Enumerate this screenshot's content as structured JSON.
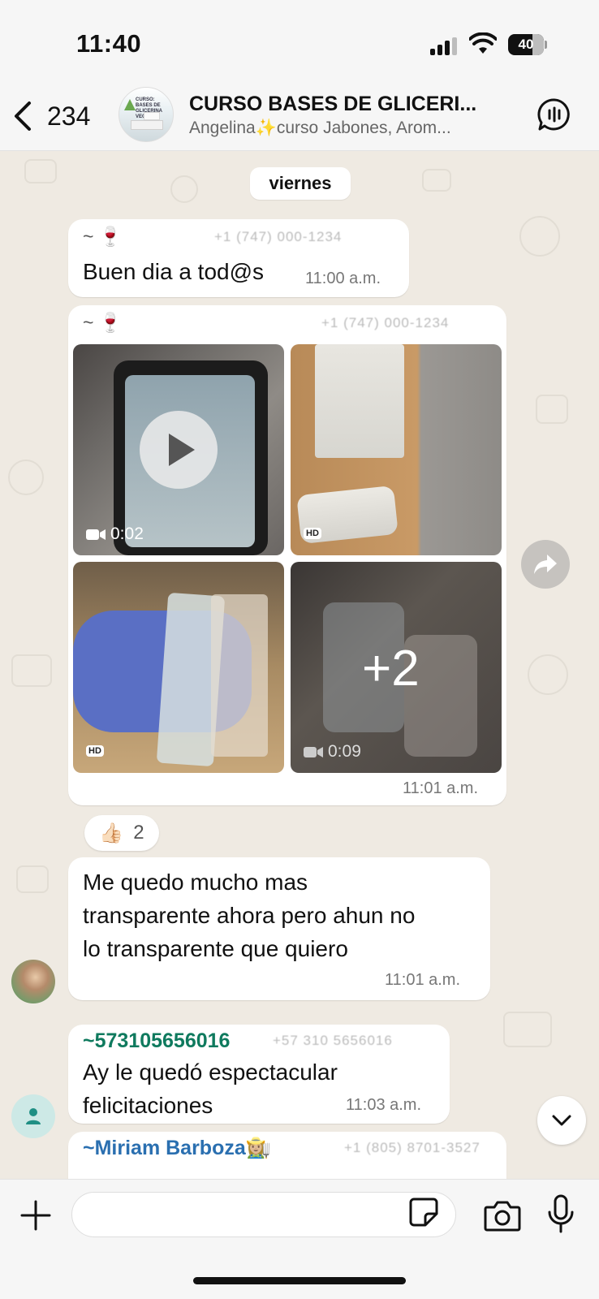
{
  "status_bar": {
    "time": "11:40",
    "battery": "40"
  },
  "header": {
    "back_count": "234",
    "title": "CURSO BASES DE GLICERI...",
    "subtitle": "Angelina✨curso Jabones, Arom...",
    "avatar_text": "CURSO: BASES DE GLICERINA VEGETAL"
  },
  "chat": {
    "date_label": "viernes",
    "messages": [
      {
        "sender": "~ 🍷",
        "sender_phone": "+1 (747) 000-1234",
        "text": "Buen dia a tod@s",
        "time": "11:00 a.m."
      },
      {
        "sender": "~ 🍷",
        "sender_phone": "+1 (747) 000-1234",
        "time": "11:01 a.m.",
        "media": [
          {
            "kind": "video",
            "duration": "0:02"
          },
          {
            "kind": "photo",
            "badge": "HD"
          },
          {
            "kind": "photo",
            "badge": "HD"
          },
          {
            "kind": "video",
            "duration": "0:09",
            "more": "+2"
          }
        ],
        "reaction": {
          "emoji": "👍🏻",
          "count": "2"
        }
      },
      {
        "text_lines": [
          "Me quedo mucho mas",
          "transparente ahora pero ahun  no",
          "lo transparente que quiero"
        ],
        "time": "11:01 a.m."
      },
      {
        "sender": "~573105656016",
        "sender_phone": "+57 310 5656016",
        "text_lines": [
          "Ay le quedó espectacular",
          "felicitaciones"
        ],
        "time": "11:03 a.m."
      },
      {
        "sender": "~Miriam Barboza👩🏼‍🌾",
        "sender_phone": "+1 (805) 8701-3527"
      }
    ]
  },
  "composer": {
    "placeholder": ""
  },
  "colors": {
    "green_sender": "#0f7a5e",
    "blue_sender": "#2a6fb0",
    "chat_bg": "#efeae2"
  }
}
